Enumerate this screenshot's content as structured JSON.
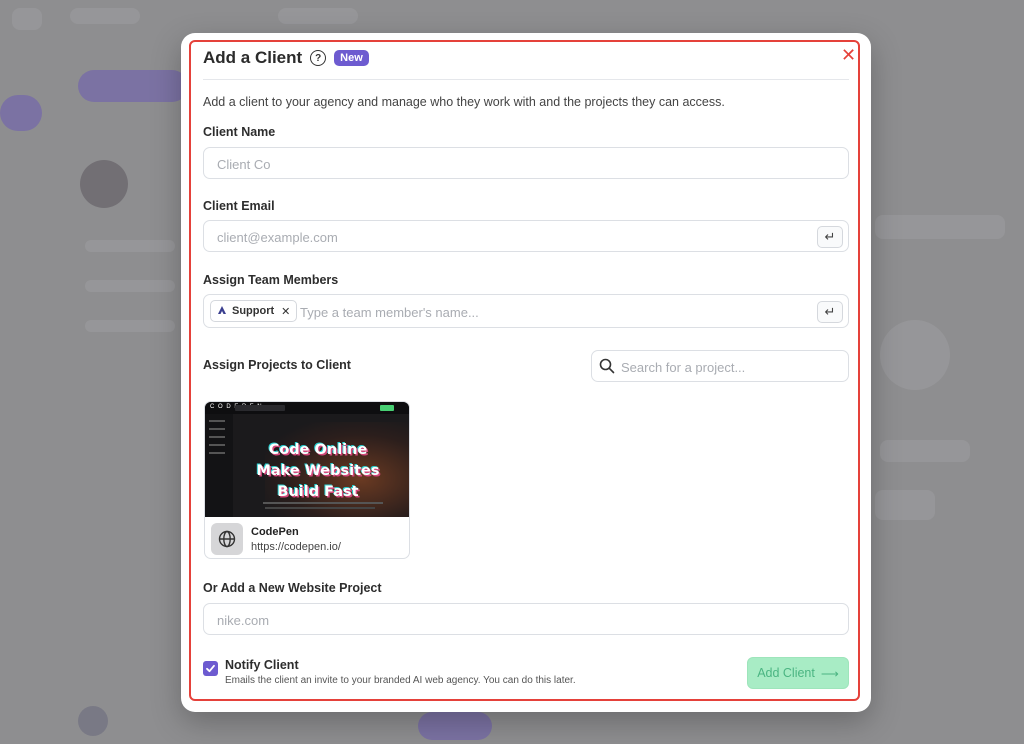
{
  "modal": {
    "title": "Add a Client",
    "badge": "New",
    "close_icon": "close-icon",
    "description": "Add a client to your agency and manage who they work with and the projects they can access."
  },
  "client_name": {
    "label": "Client Name",
    "placeholder": "Client Co"
  },
  "client_email": {
    "label": "Client Email",
    "placeholder": "client@example.com"
  },
  "team_members": {
    "label": "Assign Team Members",
    "placeholder": "Type a team member's name...",
    "selected": [
      {
        "name": "Support"
      }
    ]
  },
  "projects": {
    "label": "Assign Projects to Client",
    "search_placeholder": "Search for a project...",
    "items": [
      {
        "name": "CodePen",
        "url": "https://codepen.io/",
        "thumbnail_headline": [
          "Code Online",
          "Make Websites",
          "Build Fast"
        ],
        "thumbnail_logo": "C O D E P E N"
      }
    ]
  },
  "new_project": {
    "label": "Or Add a New Website Project",
    "placeholder": "nike.com"
  },
  "notify": {
    "checked": true,
    "title": "Notify Client",
    "description": "Emails the client an invite to your branded AI web agency. You can do this later."
  },
  "submit": {
    "label": "Add Client",
    "arrow": "⟶"
  },
  "colors": {
    "accent": "#6d5bd0",
    "error_outline": "#e5413a",
    "submit_bg": "#a8ecc5",
    "submit_text": "#4bb582"
  }
}
